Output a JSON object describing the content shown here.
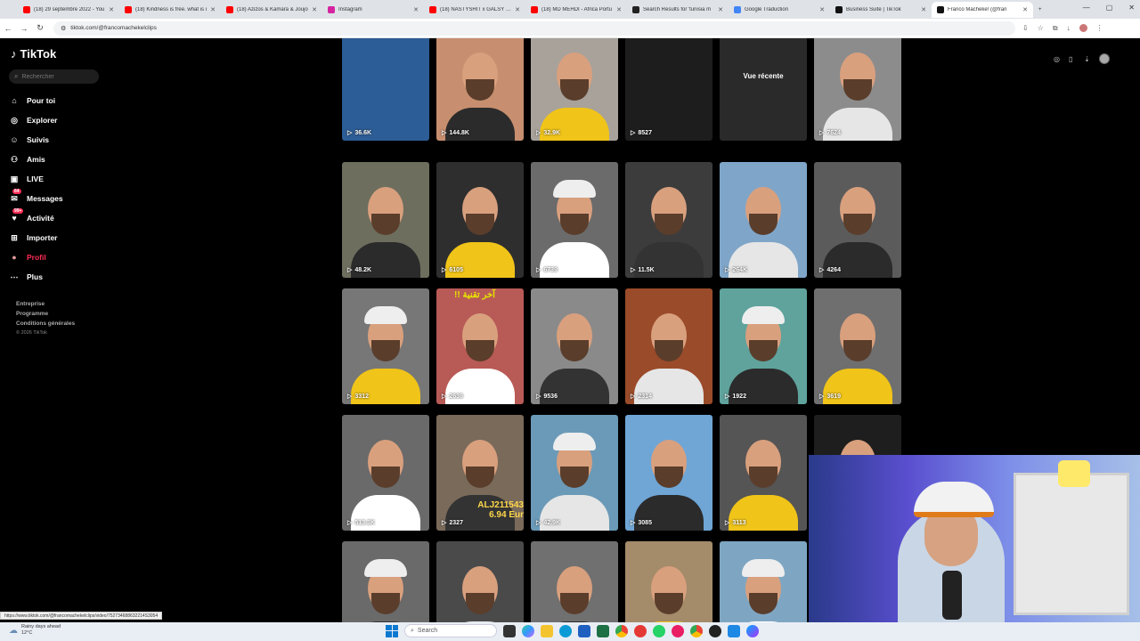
{
  "browser": {
    "tabs": [
      {
        "title": "(18) 29 septembre 2022 - You",
        "color": "#ff0000"
      },
      {
        "title": "(18) Kindness is free. what is i",
        "color": "#ff0000"
      },
      {
        "title": "(18) Azizos & Kamara & Joujo",
        "color": "#ff0000"
      },
      {
        "title": "Instagram",
        "color": "#d6249f"
      },
      {
        "title": "(18) NASTYSHIT x GALSY - fr",
        "color": "#ff0000"
      },
      {
        "title": "(18) MD MEHDI - Africa Portu",
        "color": "#ff0000"
      },
      {
        "title": "Search Results for 'tunisia m",
        "color": "#222222"
      },
      {
        "title": "Google Traduction",
        "color": "#4285f4"
      },
      {
        "title": "Business Suite | TikTok",
        "color": "#111111"
      },
      {
        "title": "Franco Macheke! (@fran",
        "color": "#111111"
      }
    ],
    "url": "tiktok.com/@francomachekelclips"
  },
  "sidebar": {
    "logo": "TikTok",
    "search_placeholder": "Rechercher",
    "items": [
      {
        "label": "Pour toi",
        "icon": "home-icon"
      },
      {
        "label": "Explorer",
        "icon": "compass-icon"
      },
      {
        "label": "Suivis",
        "icon": "following-icon"
      },
      {
        "label": "Amis",
        "icon": "friends-icon"
      },
      {
        "label": "LIVE",
        "icon": "live-icon"
      },
      {
        "label": "Messages",
        "icon": "messages-icon",
        "badge": "64"
      },
      {
        "label": "Activité",
        "icon": "activity-icon",
        "badge": "99+"
      },
      {
        "label": "Importer",
        "icon": "upload-icon"
      },
      {
        "label": "Profil",
        "icon": "profile-avatar",
        "active": true
      },
      {
        "label": "Plus",
        "icon": "more-icon"
      }
    ],
    "footer": [
      "Entreprise",
      "Programme",
      "Conditions générales"
    ],
    "copyright": "© 2026 TikTok"
  },
  "videos": [
    {
      "views": "36.6K",
      "bg": "#2d5d96"
    },
    {
      "views": "144.8K",
      "bg": "#c78f6f"
    },
    {
      "views": "32.9K",
      "bg": "#a8a29a"
    },
    {
      "views": "8527",
      "bg": "#1d1d1d"
    },
    {
      "views": "",
      "bg": "#2a2a2a",
      "overlay": "Vue récente"
    },
    {
      "views": "7624",
      "bg": "#8c8c8c"
    },
    {
      "views": "48.2K",
      "bg": "#6e6e5e"
    },
    {
      "views": "6105",
      "bg": "#2e2e2e"
    },
    {
      "views": "6739",
      "bg": "#6b6b6b"
    },
    {
      "views": "11.5K",
      "bg": "#3c3c3c"
    },
    {
      "views": "264K",
      "bg": "#7fa6c9"
    },
    {
      "views": "4264",
      "bg": "#5b5b5b"
    },
    {
      "views": "3312",
      "bg": "#777777"
    },
    {
      "views": "2636",
      "bg": "#b85a55",
      "arabic": "!! آخر تقنية"
    },
    {
      "views": "9536",
      "bg": "#8a8a8a"
    },
    {
      "views": "2314",
      "bg": "#9a4b2a"
    },
    {
      "views": "1922",
      "bg": "#5fa39c"
    },
    {
      "views": "3619",
      "bg": "#6f6f6f"
    },
    {
      "views": "513.3K",
      "bg": "#6a6a6a"
    },
    {
      "views": "2327",
      "bg": "#7a6a5a",
      "caption": "ALJ211543 6.94 Eur"
    },
    {
      "views": "42.9K",
      "bg": "#6b9ab8"
    },
    {
      "views": "3085",
      "bg": "#6fa6d6"
    },
    {
      "views": "3113",
      "bg": "#555555"
    },
    {
      "views": "",
      "bg": "#1e1e1e"
    },
    {
      "views": "",
      "bg": "#6a6a6a"
    },
    {
      "views": "",
      "bg": "#4a4a4a"
    },
    {
      "views": "",
      "bg": "#707070"
    },
    {
      "views": "",
      "bg": "#a48b6a"
    },
    {
      "views": "",
      "bg": "#7ea6c2"
    }
  ],
  "statusbar_url": "https://www.tiktok.com/@francomachekelclips/video/752734688632214S3054",
  "taskbar": {
    "weather_line1": "Rainy days ahead",
    "weather_line2": "12°C",
    "search_label": "Search"
  }
}
